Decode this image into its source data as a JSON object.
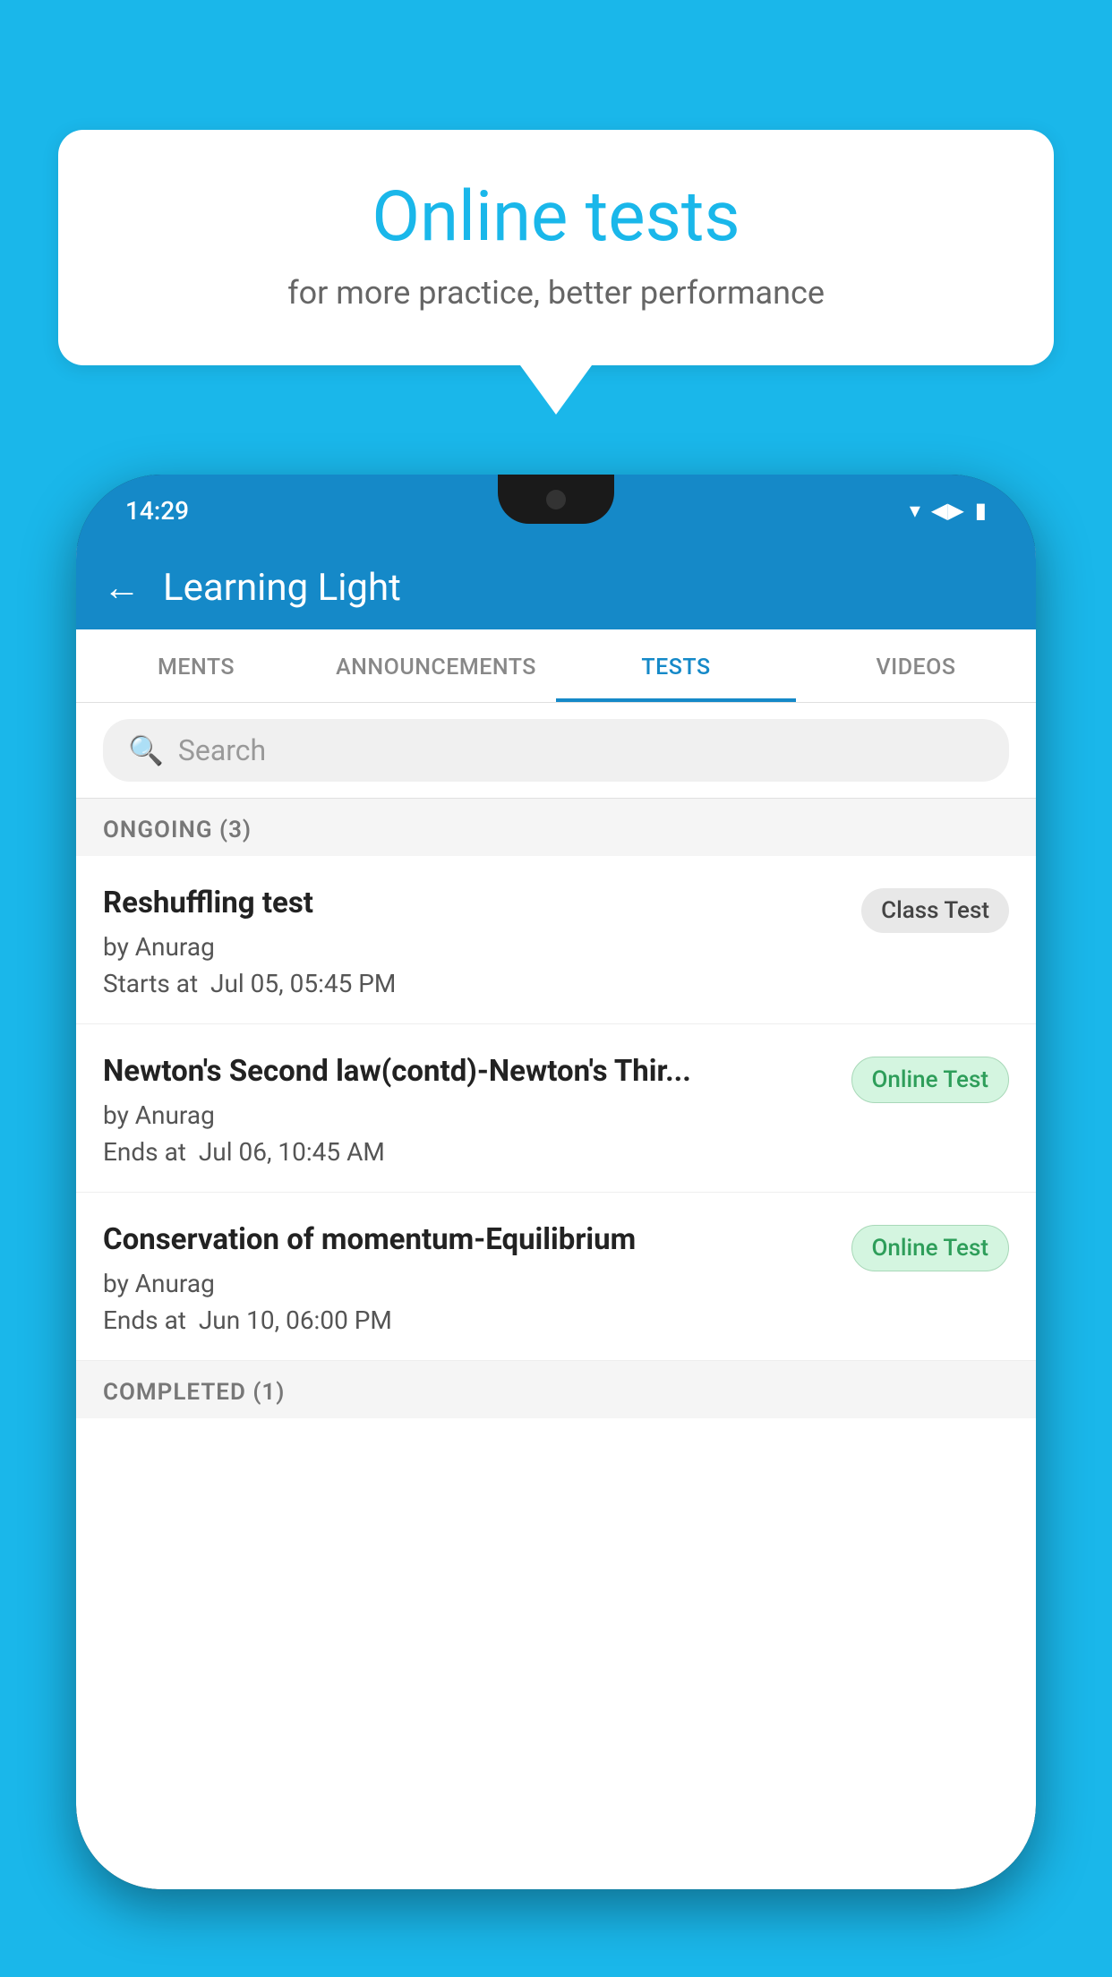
{
  "background": {
    "color": "#1ab7ea"
  },
  "speech_bubble": {
    "title": "Online tests",
    "subtitle": "for more practice, better performance"
  },
  "phone": {
    "status_bar": {
      "time": "14:29",
      "wifi": "▾",
      "signal": "▲",
      "battery": "▮"
    },
    "header": {
      "back_label": "←",
      "title": "Learning Light"
    },
    "tabs": [
      {
        "label": "MENTS",
        "active": false
      },
      {
        "label": "ANNOUNCEMENTS",
        "active": false
      },
      {
        "label": "TESTS",
        "active": true
      },
      {
        "label": "VIDEOS",
        "active": false
      }
    ],
    "search": {
      "placeholder": "Search"
    },
    "ongoing_section": {
      "label": "ONGOING (3)"
    },
    "tests": [
      {
        "name": "Reshuffling test",
        "author": "by Anurag",
        "time_label": "Starts at",
        "time": "Jul 05, 05:45 PM",
        "badge": "Class Test",
        "badge_type": "class"
      },
      {
        "name": "Newton's Second law(contd)-Newton's Thir...",
        "author": "by Anurag",
        "time_label": "Ends at",
        "time": "Jul 06, 10:45 AM",
        "badge": "Online Test",
        "badge_type": "online"
      },
      {
        "name": "Conservation of momentum-Equilibrium",
        "author": "by Anurag",
        "time_label": "Ends at",
        "time": "Jun 10, 06:00 PM",
        "badge": "Online Test",
        "badge_type": "online"
      }
    ],
    "completed_section": {
      "label": "COMPLETED (1)"
    }
  }
}
